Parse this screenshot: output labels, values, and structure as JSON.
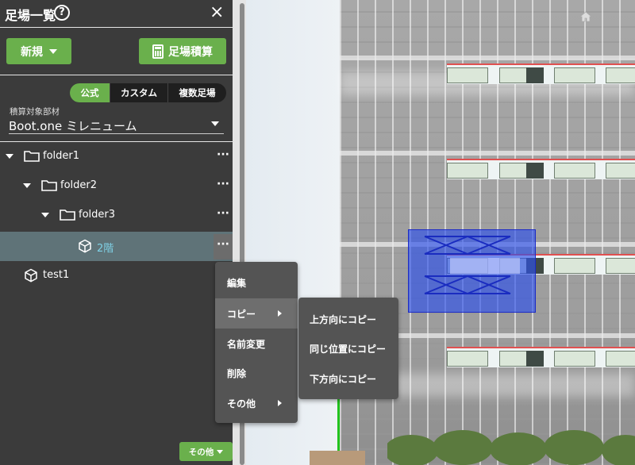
{
  "panel": {
    "title": "足場一覧",
    "help_icon": "?",
    "close_icon": "×",
    "new_button": "新規",
    "calc_button": "足場積算",
    "tabs": [
      "公式",
      "カスタム",
      "複数足場"
    ],
    "target_label": "積算対象部材",
    "target_value": "Boot.one ミレニューム",
    "tree": [
      {
        "label": "folder1",
        "type": "folder"
      },
      {
        "label": "folder2",
        "type": "folder"
      },
      {
        "label": "folder3",
        "type": "folder"
      },
      {
        "label": "2階",
        "type": "item",
        "selected": true
      },
      {
        "label": "test1",
        "type": "item"
      }
    ],
    "dots": "···",
    "other_button": "その他"
  },
  "context_menu": {
    "items": [
      "編集",
      "コピー",
      "名前変更",
      "削除",
      "その他"
    ],
    "submenu": [
      "上方向にコピー",
      "同じ位置にコピー",
      "下方向にコピー"
    ]
  },
  "colors": {
    "panel_bg": "#3b3b3b",
    "accent_green": "#6ab04c",
    "selected_row": "#5f7378",
    "selected_text": "#7fd1e6",
    "selection_box": "#2d50eb"
  }
}
